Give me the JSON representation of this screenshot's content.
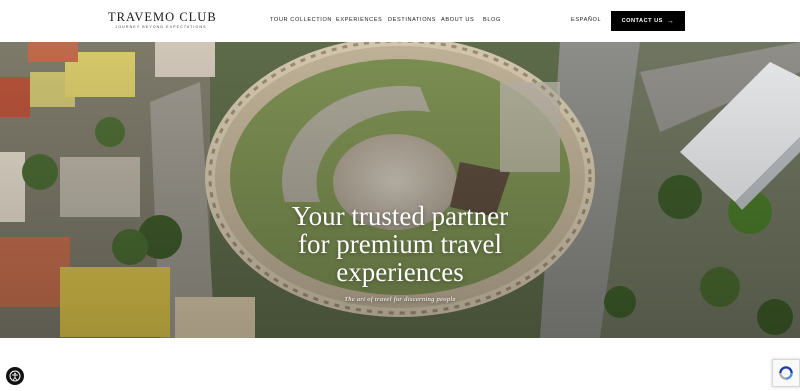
{
  "brand": {
    "name": "TRAVEMO CLUB",
    "tagline": "JOURNEY BEYOND EXPECTATIONS"
  },
  "nav": {
    "items": [
      {
        "label": "TOUR COLLECTION"
      },
      {
        "label": "EXPERIENCES"
      },
      {
        "label": "DESTINATIONS"
      },
      {
        "label": "ABOUT US"
      },
      {
        "label": "BLOG"
      }
    ],
    "language": "ESPAÑOL",
    "contact_label": "CONTACT US",
    "contact_arrow": "→"
  },
  "hero": {
    "title_lines": [
      "Your trusted partner",
      "for premium travel",
      "experiences"
    ],
    "subtitle": "The art of travel for discerning people"
  },
  "widgets": {
    "accessibility_icon": "accessibility-icon",
    "recaptcha_icon": "recaptcha-icon"
  },
  "colors": {
    "contact_button_bg": "#000000",
    "hero_text": "#ffffff",
    "header_bg": "#ffffff"
  }
}
